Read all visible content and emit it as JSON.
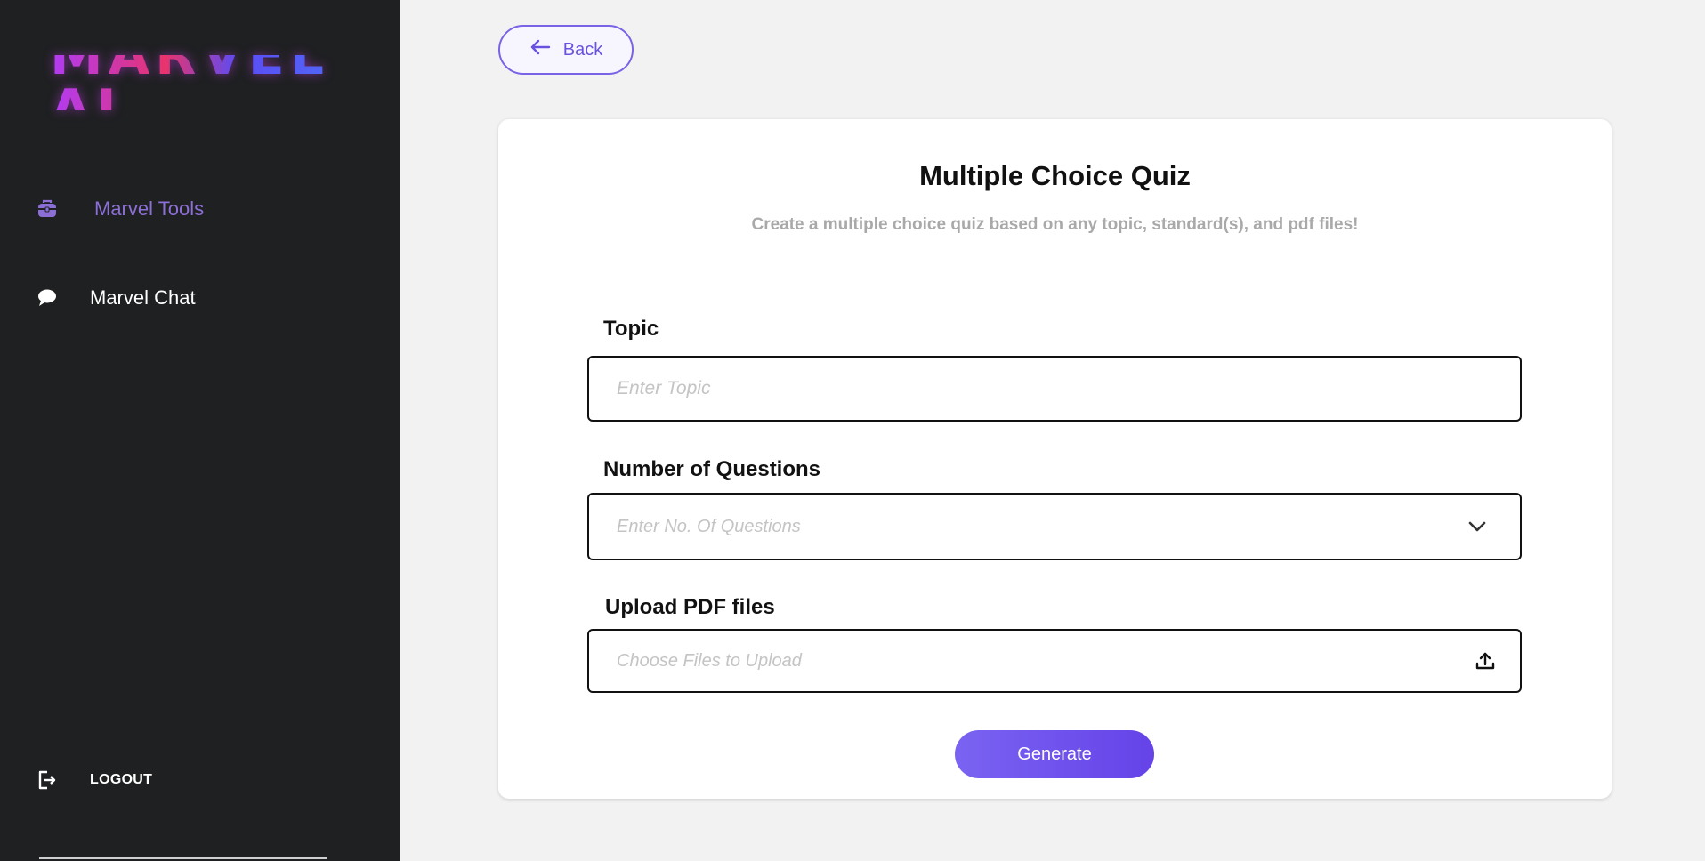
{
  "brand": {
    "logo_text": "MARVEL AI"
  },
  "sidebar": {
    "items": [
      {
        "label": "Marvel Tools",
        "icon": "toolbox-icon"
      },
      {
        "label": "Marvel Chat",
        "icon": "chat-bubble-icon"
      }
    ],
    "logout_label": "LOGOUT"
  },
  "back_button": {
    "label": "Back"
  },
  "form": {
    "title": "Multiple Choice Quiz",
    "subtitle": "Create a multiple choice quiz based on any topic, standard(s), and pdf files!",
    "topic": {
      "label": "Topic",
      "placeholder": "Enter Topic",
      "value": ""
    },
    "questions": {
      "label": "Number of Questions",
      "placeholder": "Enter No. Of Questions"
    },
    "upload": {
      "label": "Upload PDF files",
      "placeholder": "Choose Files to Upload"
    },
    "submit_label": "Generate"
  },
  "colors": {
    "accent": "#6a52e0",
    "sidebar_bg": "#1f2022",
    "active_nav": "#8b6fd6"
  }
}
